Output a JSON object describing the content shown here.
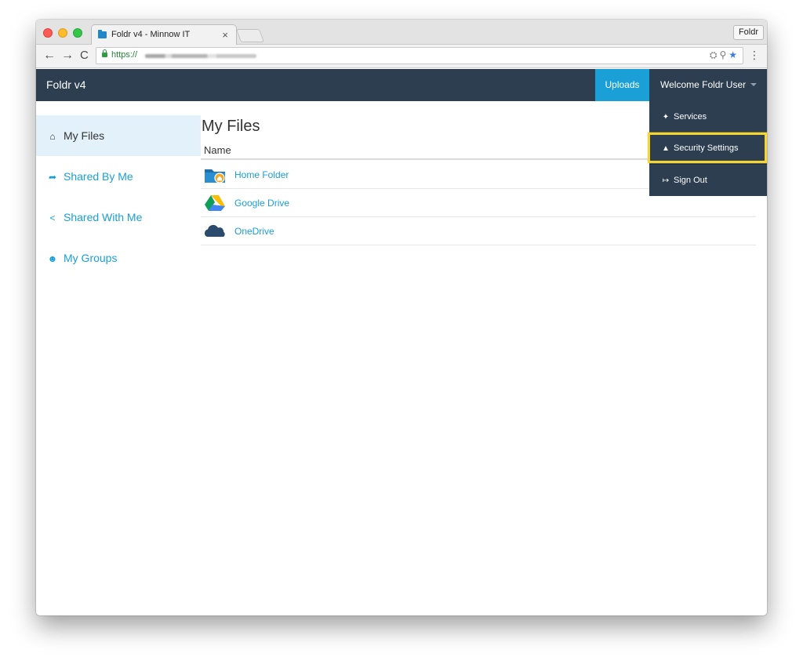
{
  "browser": {
    "tab_title": "Foldr v4 - Minnow IT",
    "tab_close": "×",
    "profile_label": "Foldr",
    "url_prefix": "https://",
    "nav_back": "←",
    "nav_forward": "→",
    "nav_reload": "C",
    "menu": "⋮",
    "omni_icons": "⛭⚲"
  },
  "navbar": {
    "brand": "Foldr v4",
    "uploads_label": "Uploads",
    "welcome_label": "Welcome Foldr User"
  },
  "sidebar": {
    "items": [
      {
        "label": "My Files",
        "icon": "home-icon",
        "glyph": "⌂",
        "active": true
      },
      {
        "label": "Shared By Me",
        "icon": "share-arrow-icon",
        "glyph": "➦",
        "active": false
      },
      {
        "label": "Shared With Me",
        "icon": "share-nodes-icon",
        "glyph": "<",
        "active": false
      },
      {
        "label": "My Groups",
        "icon": "users-icon",
        "glyph": "☻",
        "active": false
      }
    ]
  },
  "main": {
    "title": "My Files",
    "column_name": "Name",
    "rows": [
      {
        "label": "Home Folder",
        "icon": "home-folder-icon"
      },
      {
        "label": "Google Drive",
        "icon": "google-drive-icon"
      },
      {
        "label": "OneDrive",
        "icon": "onedrive-icon"
      }
    ]
  },
  "dropdown": {
    "items": [
      {
        "label": "Services",
        "icon": "puzzle-icon",
        "glyph": "✦"
      },
      {
        "label": "Security Settings",
        "icon": "lock-icon",
        "glyph": "▲"
      },
      {
        "label": "Sign Out",
        "icon": "sign-out-icon",
        "glyph": "↦"
      }
    ]
  },
  "colors": {
    "navbar": "#2c3e50",
    "accent": "#1a9fd6",
    "highlight": "#f5d531",
    "sidebar_active": "#e3f1fb"
  }
}
